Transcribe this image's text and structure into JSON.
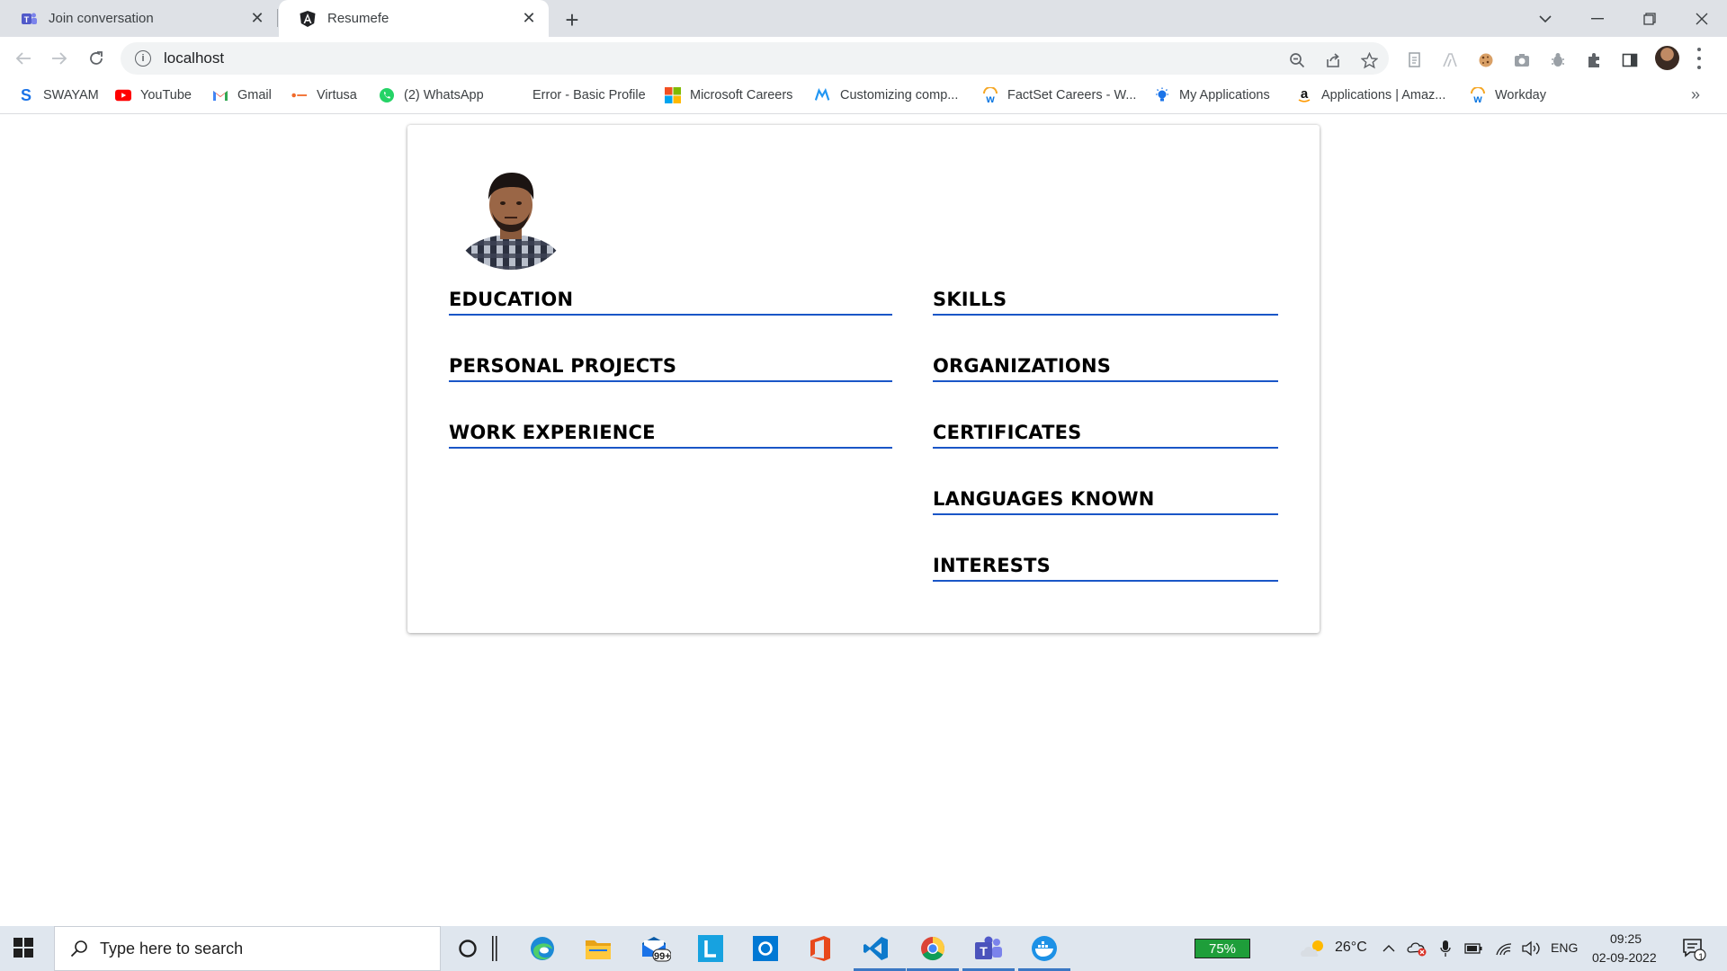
{
  "browser": {
    "tabs": [
      {
        "title": "Join conversation",
        "icon": "teams-icon",
        "active": false
      },
      {
        "title": "Resumefe",
        "icon": "angular-icon",
        "active": true
      }
    ],
    "url": "localhost"
  },
  "bookmarks": [
    {
      "label": "SWAYAM",
      "icon": "swayam-icon"
    },
    {
      "label": "YouTube",
      "icon": "youtube-icon"
    },
    {
      "label": "Gmail",
      "icon": "gmail-icon"
    },
    {
      "label": "Virtusa",
      "icon": "virtusa-icon"
    },
    {
      "label": "(2) WhatsApp",
      "icon": "whatsapp-icon"
    },
    {
      "label": "Error - Basic Profile",
      "icon": ""
    },
    {
      "label": "Microsoft Careers",
      "icon": "microsoft-icon"
    },
    {
      "label": "Customizing comp...",
      "icon": "material-icon"
    },
    {
      "label": "FactSet Careers - W...",
      "icon": "workday-icon"
    },
    {
      "label": "My Applications",
      "icon": "bulb-icon"
    },
    {
      "label": "Applications | Amaz...",
      "icon": "amazon-icon"
    },
    {
      "label": "Workday",
      "icon": "workday-icon"
    }
  ],
  "resume": {
    "sections_left": [
      "EDUCATION",
      "PERSONAL PROJECTS",
      "WORK EXPERIENCE"
    ],
    "sections_right": [
      "SKILLS",
      "ORGANIZATIONS",
      "CERTIFICATES",
      "LANGUAGES KNOWN",
      "INTERESTS"
    ]
  },
  "taskbar": {
    "search_placeholder": "Type here to search",
    "mail_badge": "99+",
    "battery": "75%",
    "weather": "26°C",
    "language": "ENG",
    "time": "09:25",
    "date": "02-09-2022",
    "notification_count": "1"
  },
  "colors": {
    "section_underline": "#1a56c7",
    "tab_strip": "#dee1e6",
    "taskbar": "#dfe6ee"
  }
}
